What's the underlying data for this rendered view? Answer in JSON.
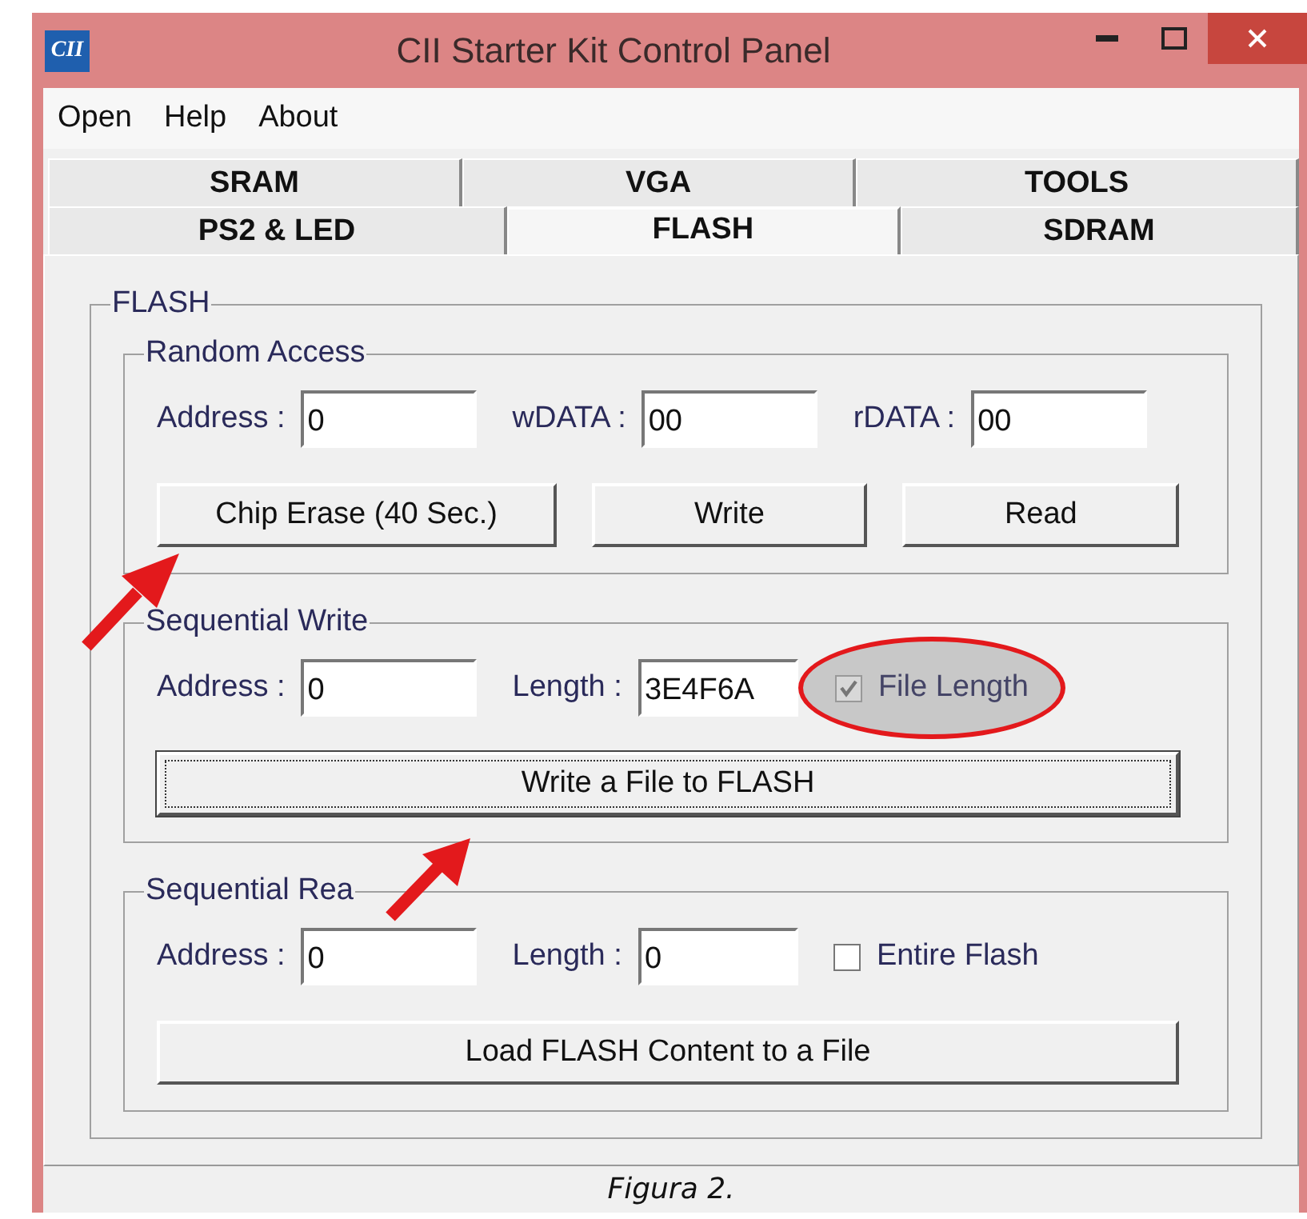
{
  "window": {
    "title": "CII Starter Kit Control Panel",
    "logo": "CII"
  },
  "menu": [
    "Open",
    "Help",
    "About"
  ],
  "tab_rows": [
    [
      {
        "label": "SRAM",
        "selected": false
      },
      {
        "label": "VGA",
        "selected": false
      },
      {
        "label": "TOOLS",
        "selected": false
      }
    ],
    [
      {
        "label": "PS2 & LED",
        "selected": false
      },
      {
        "label": "FLASH",
        "selected": true
      },
      {
        "label": "SDRAM",
        "selected": false
      }
    ]
  ],
  "panel": {
    "title": "FLASH",
    "groups": [
      {
        "title": "Random Access",
        "fields": [
          {
            "label": "Address :",
            "value": "0"
          },
          {
            "label": "wDATA :",
            "value": "00"
          },
          {
            "label": "rDATA :",
            "value": "00"
          }
        ],
        "buttons": [
          {
            "label": "Chip Erase (40 Sec.)",
            "focused": false
          },
          {
            "label": "Write",
            "focused": false
          },
          {
            "label": "Read",
            "focused": false
          }
        ]
      },
      {
        "title": "Sequential Write",
        "fields": [
          {
            "label": "Address :",
            "value": "0"
          },
          {
            "label": "Length :",
            "value": "3E4F6A"
          }
        ],
        "checkbox": {
          "label": "File Length",
          "checked": true,
          "disabled": true,
          "highlighted": true
        },
        "buttons": [
          {
            "label": "Write a File to FLASH",
            "focused": true
          }
        ]
      },
      {
        "title": "Sequential Rea",
        "fields": [
          {
            "label": "Address :",
            "value": "0"
          },
          {
            "label": "Length :",
            "value": "0"
          }
        ],
        "checkbox": {
          "label": "Entire Flash",
          "checked": false,
          "disabled": false,
          "highlighted": false
        },
        "buttons": [
          {
            "label": "Load FLASH Content to a File",
            "focused": false
          }
        ]
      }
    ]
  },
  "caption": "Figura 2."
}
